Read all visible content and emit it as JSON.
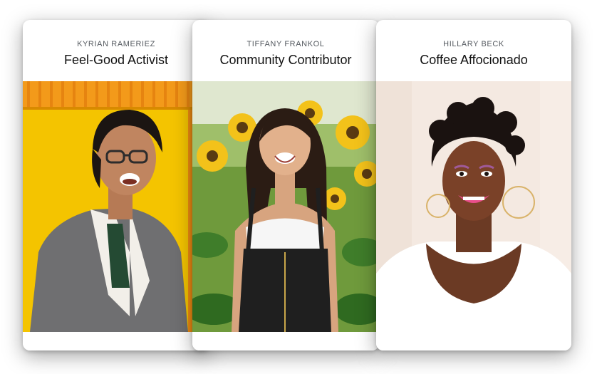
{
  "cards": [
    {
      "name": "KYRIAN RAMERIEZ",
      "title": "Feel-Good Activist",
      "photo_icon": "person-laughing-yellow-wall"
    },
    {
      "name": "TIFFANY FRANKOL",
      "title": "Community Contributor",
      "photo_icon": "person-smiling-sunflowers"
    },
    {
      "name": "HILLARY BECK",
      "title": "Coffee Affocionado",
      "photo_icon": "person-smiling-light-background"
    }
  ],
  "colors": {
    "card_background": "#ffffff",
    "name_text": "#555a60",
    "title_text": "#111111",
    "wall_yellow": "#f4c400",
    "wall_orange": "#f39a1a",
    "sunflower": "#f3c21a",
    "leaf_green": "#3f7d2a"
  }
}
